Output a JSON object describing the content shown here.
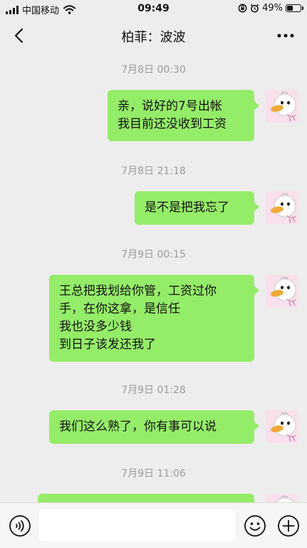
{
  "status_bar": {
    "carrier": "中国移动",
    "time": "09:49",
    "battery": "49%",
    "battery_level": 0.49
  },
  "header": {
    "title": "柏菲：波波"
  },
  "messages": [
    {
      "time": "7月8日 00:30",
      "text": "亲，说好的7号出帐\n我目前还没收到工资"
    },
    {
      "time": "7月8日 21:18",
      "text": "是不是把我忘了"
    },
    {
      "time": "7月9日 00:15",
      "text": "王总把我划给你管，工资过你\n手，在你这拿，是信任\n我也没多少钱\n到日子该发还我了"
    },
    {
      "time": "7月9日 01:28",
      "text": "我们这么熟了，你有事可以说"
    },
    {
      "time": "7月9日 11:06",
      "text": ""
    }
  ],
  "icons": {
    "back": "chevron-left-icon",
    "more": "more-icon",
    "voice": "voice-icon",
    "emoji": "emoji-icon",
    "plus": "plus-icon",
    "avatar": "duck-avatar"
  },
  "colors": {
    "bubble": "#95ec69",
    "background": "#ededed",
    "timestamp": "#9c9c9c"
  }
}
